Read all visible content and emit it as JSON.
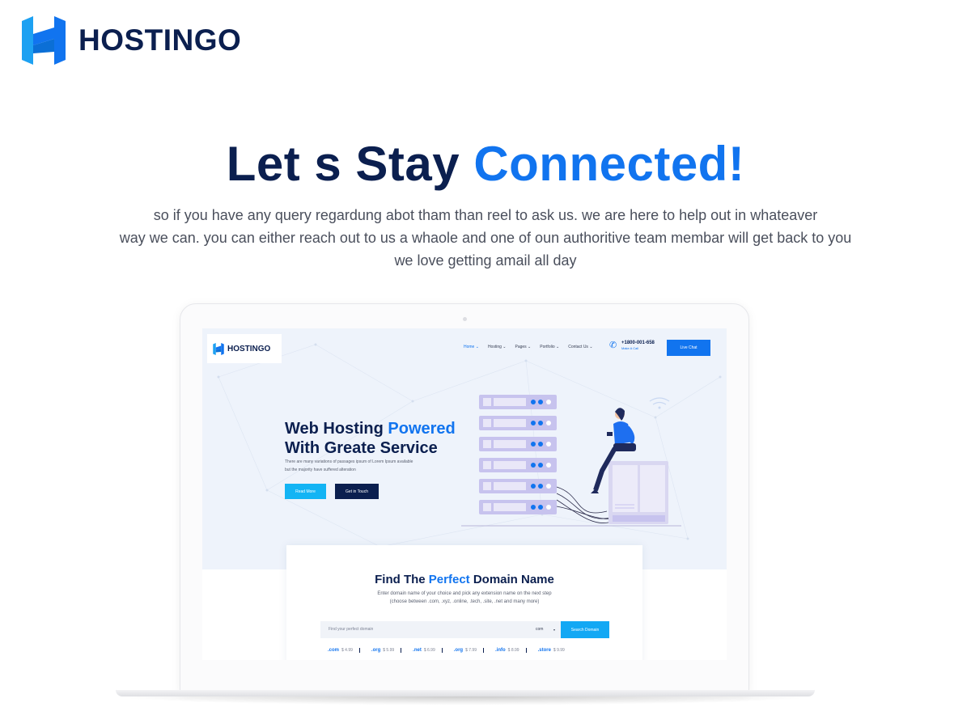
{
  "brand": {
    "name": "HOSTINGO",
    "icon": "hostingo-h-logo",
    "color": "#0b1f4f",
    "accent": "#1174ef"
  },
  "headline": {
    "part1": "Let s Stay ",
    "accent": "Connected!"
  },
  "intro": {
    "line1": "so if you have any query regardung abot tham than reel to ask us. we are here to help out in whateaver",
    "line2": "way we can. you can either reach out to us a whaole and one of oun authoritive team membar will get back to you",
    "line3": "we love getting amail all day"
  },
  "mockup": {
    "logo": "HOSTINGO",
    "nav": [
      {
        "label": "Home",
        "active": true
      },
      {
        "label": "Hosting",
        "active": false
      },
      {
        "label": "Pages",
        "active": false
      },
      {
        "label": "Portfolio",
        "active": false
      },
      {
        "label": "Contact Us",
        "active": false
      }
    ],
    "phone": {
      "number": "+1800-001-658",
      "sub": "Make A Call"
    },
    "live_chat": "Live Chat",
    "hero": {
      "title_part1": "Web Hosting ",
      "title_accent": "Powered",
      "title_line2": "With Greate Service",
      "desc_line1": "There are many variations of passages ipsum of Lorem Ipsum available",
      "desc_line2": "but the majority have suffered alteration",
      "read_more": "Read More",
      "get_in_touch": "Get in Touch"
    },
    "domain": {
      "title_part1": "Find The ",
      "title_accent": "Perfect",
      "title_part2": " Domain Name",
      "sub_line1": "Enter domain name of your choice and pick any extension name on the next step",
      "sub_line2": "(choose between .com, .xyz, .online, .tech, .site, .net and many more)",
      "placeholder": "Find your perfect domain",
      "select_value": "com",
      "search_button": "Search Domain",
      "prices": [
        {
          "ext": ".com",
          "price": "$ 4.99"
        },
        {
          "ext": ".org",
          "price": "$ 5.99"
        },
        {
          "ext": ".net",
          "price": "$ 6.99"
        },
        {
          "ext": ".org",
          "price": "$ 7.99"
        },
        {
          "ext": ".info",
          "price": "$ 8.99"
        },
        {
          "ext": ".store",
          "price": "$ 9.99"
        }
      ]
    }
  }
}
